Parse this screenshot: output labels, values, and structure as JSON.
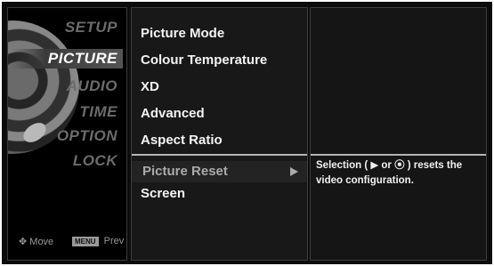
{
  "sidebar": {
    "categories": [
      {
        "label": "SETUP"
      },
      {
        "label": "PICTURE"
      },
      {
        "label": "AUDIO"
      },
      {
        "label": "TIME"
      },
      {
        "label": "OPTION"
      },
      {
        "label": "LOCK"
      }
    ],
    "active_category": "PICTURE",
    "footer": {
      "move_label": "Move",
      "menu_key_label": "MENU",
      "prev_label": "Prev"
    }
  },
  "options": {
    "items": [
      {
        "label": "Picture Mode"
      },
      {
        "label": "Colour Temperature"
      },
      {
        "label": "XD"
      },
      {
        "label": "Advanced"
      },
      {
        "label": "Aspect Ratio"
      },
      {
        "label": "Picture Reset"
      },
      {
        "label": "Screen"
      }
    ],
    "selected_index": 5
  },
  "help": {
    "text": "Selection ( ▶ or ⦿ ) resets the video configuration."
  },
  "colors": {
    "background": "#0c0c0c",
    "active_text": "#ffffff",
    "inactive_text": "#6b6b6b",
    "selected_text": "#aaaaaa"
  }
}
